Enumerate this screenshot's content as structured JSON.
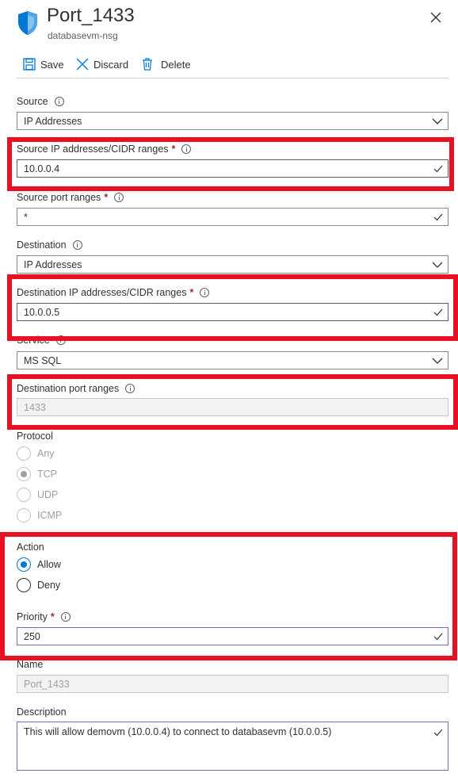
{
  "header": {
    "title": "Port_1433",
    "subtitle": "databasevm-nsg",
    "icon": "shield-icon",
    "close_icon": "close-icon"
  },
  "toolbar": {
    "save_label": "Save",
    "discard_label": "Discard",
    "delete_label": "Delete"
  },
  "form": {
    "source": {
      "label": "Source",
      "value": "IP Addresses"
    },
    "source_ip": {
      "label": "Source IP addresses/CIDR ranges",
      "required_mark": "*",
      "value": "10.0.0.4"
    },
    "source_port": {
      "label": "Source port ranges",
      "required_mark": "*",
      "value": "*"
    },
    "destination": {
      "label": "Destination",
      "value": "IP Addresses"
    },
    "destination_ip": {
      "label": "Destination IP addresses/CIDR ranges",
      "required_mark": "*",
      "value": "10.0.0.5"
    },
    "service": {
      "label": "Service",
      "value": "MS SQL"
    },
    "destination_port": {
      "label": "Destination port ranges",
      "value": "1433"
    },
    "protocol": {
      "label": "Protocol",
      "options": [
        "Any",
        "TCP",
        "UDP",
        "ICMP"
      ],
      "selected": "TCP"
    },
    "action": {
      "label": "Action",
      "options": [
        "Allow",
        "Deny"
      ],
      "selected": "Allow"
    },
    "priority": {
      "label": "Priority",
      "required_mark": "*",
      "value": "250"
    },
    "name": {
      "label": "Name",
      "value": "Port_1433"
    },
    "description": {
      "label": "Description",
      "value": "This will allow demovm (10.0.0.4) to connect to databasevm (10.0.0.5)"
    }
  },
  "colors": {
    "highlight": "#e81123",
    "accent": "#0078d4",
    "shield": "#0078d4"
  }
}
